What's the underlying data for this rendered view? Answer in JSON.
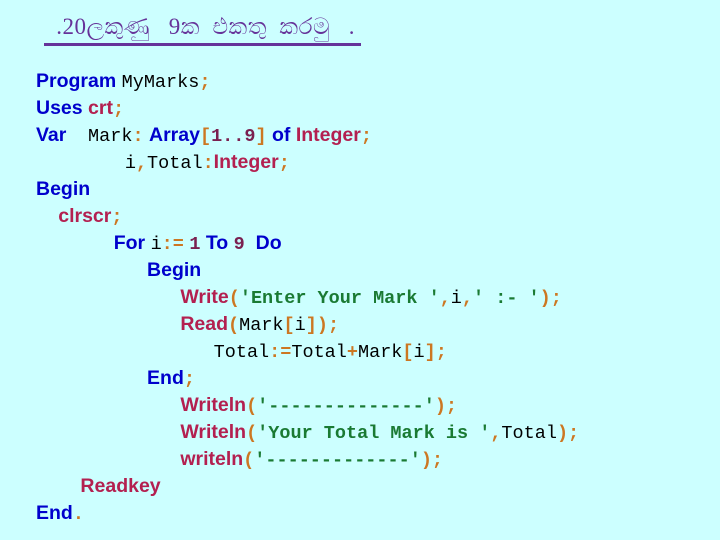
{
  "slide": {
    "background_color": "#ccffff",
    "title": {
      "text": " .20ලකුණු   9ක  එකතු  කරමු   .",
      "color": "#663399",
      "underlined": true
    }
  },
  "colors": {
    "keyword": "#0000cc",
    "identifier": "#000000",
    "procedure": "#b32050",
    "type": "#b32050",
    "punctuation": "#cc7722",
    "number": "#7a2050",
    "string": "#1a7a33",
    "background": "#ccffff",
    "title": "#663399"
  },
  "code": {
    "language": "Pascal",
    "program_name": "MyMarks",
    "lines": [
      {
        "indent": "",
        "tokens": [
          {
            "t": "Program",
            "c": "kw"
          },
          {
            "t": " ",
            "c": "sp"
          },
          {
            "t": "MyMarks",
            "c": "id"
          },
          {
            "t": ";",
            "c": "punc"
          }
        ]
      },
      {
        "indent": "",
        "tokens": [
          {
            "t": "Uses",
            "c": "kw"
          },
          {
            "t": " ",
            "c": "sp"
          },
          {
            "t": "crt",
            "c": "proc"
          },
          {
            "t": ";",
            "c": "punc"
          }
        ]
      },
      {
        "indent": "",
        "tokens": [
          {
            "t": "Var",
            "c": "kw"
          },
          {
            "t": "    ",
            "c": "sp"
          },
          {
            "t": "Mark",
            "c": "id"
          },
          {
            "t": ":",
            "c": "punc"
          },
          {
            "t": " ",
            "c": "sp"
          },
          {
            "t": "Array",
            "c": "kw"
          },
          {
            "t": "[",
            "c": "punc"
          },
          {
            "t": "1..9",
            "c": "num"
          },
          {
            "t": "]",
            "c": "punc"
          },
          {
            "t": " ",
            "c": "sp"
          },
          {
            "t": "of",
            "c": "kw"
          },
          {
            "t": " ",
            "c": "sp"
          },
          {
            "t": "Integer",
            "c": "type"
          },
          {
            "t": ";",
            "c": "punc"
          }
        ]
      },
      {
        "indent": "        ",
        "tokens": [
          {
            "t": "i",
            "c": "id"
          },
          {
            "t": ",",
            "c": "punc"
          },
          {
            "t": "Total",
            "c": "id"
          },
          {
            "t": ":",
            "c": "punc"
          },
          {
            "t": "Integer",
            "c": "type"
          },
          {
            "t": ";",
            "c": "punc"
          }
        ]
      },
      {
        "indent": "",
        "tokens": [
          {
            "t": "Begin",
            "c": "kw"
          }
        ]
      },
      {
        "indent": "  ",
        "tokens": [
          {
            "t": "clrscr",
            "c": "proc"
          },
          {
            "t": ";",
            "c": "punc"
          }
        ]
      },
      {
        "indent": "       ",
        "tokens": [
          {
            "t": "For",
            "c": "kw"
          },
          {
            "t": " ",
            "c": "sp"
          },
          {
            "t": "i",
            "c": "id"
          },
          {
            "t": ":=",
            "c": "punc"
          },
          {
            "t": " ",
            "c": "sp"
          },
          {
            "t": "1",
            "c": "num"
          },
          {
            "t": " ",
            "c": "sp"
          },
          {
            "t": "To",
            "c": "kw"
          },
          {
            "t": " ",
            "c": "sp"
          },
          {
            "t": "9",
            "c": "num"
          },
          {
            "t": "  ",
            "c": "sp"
          },
          {
            "t": "Do",
            "c": "kw"
          }
        ]
      },
      {
        "indent": "          ",
        "tokens": [
          {
            "t": "Begin",
            "c": "kw"
          }
        ]
      },
      {
        "indent": "             ",
        "tokens": [
          {
            "t": "Write",
            "c": "proc"
          },
          {
            "t": "(",
            "c": "punc"
          },
          {
            "t": "'Enter Your Mark '",
            "c": "str"
          },
          {
            "t": ",",
            "c": "punc"
          },
          {
            "t": "i",
            "c": "id"
          },
          {
            "t": ",",
            "c": "punc"
          },
          {
            "t": "' :- '",
            "c": "str"
          },
          {
            "t": ")",
            "c": "punc"
          },
          {
            "t": ";",
            "c": "punc"
          }
        ]
      },
      {
        "indent": "             ",
        "tokens": [
          {
            "t": "Read",
            "c": "proc"
          },
          {
            "t": "(",
            "c": "punc"
          },
          {
            "t": "Mark",
            "c": "id"
          },
          {
            "t": "[",
            "c": "punc"
          },
          {
            "t": "i",
            "c": "id"
          },
          {
            "t": "]",
            "c": "punc"
          },
          {
            "t": ")",
            "c": "punc"
          },
          {
            "t": ";",
            "c": "punc"
          }
        ]
      },
      {
        "indent": "                ",
        "tokens": [
          {
            "t": "Total",
            "c": "id"
          },
          {
            "t": ":=",
            "c": "punc"
          },
          {
            "t": "Total",
            "c": "id"
          },
          {
            "t": "+",
            "c": "punc"
          },
          {
            "t": "Mark",
            "c": "id"
          },
          {
            "t": "[",
            "c": "punc"
          },
          {
            "t": "i",
            "c": "id"
          },
          {
            "t": "]",
            "c": "punc"
          },
          {
            "t": ";",
            "c": "punc"
          }
        ]
      },
      {
        "indent": "          ",
        "tokens": [
          {
            "t": "End",
            "c": "kw"
          },
          {
            "t": ";",
            "c": "punc"
          }
        ]
      },
      {
        "indent": "             ",
        "tokens": [
          {
            "t": "Writeln",
            "c": "proc"
          },
          {
            "t": "(",
            "c": "punc"
          },
          {
            "t": "'--------------'",
            "c": "str"
          },
          {
            "t": ")",
            "c": "punc"
          },
          {
            "t": ";",
            "c": "punc"
          }
        ]
      },
      {
        "indent": "             ",
        "tokens": [
          {
            "t": "Writeln",
            "c": "proc"
          },
          {
            "t": "(",
            "c": "punc"
          },
          {
            "t": "'Your Total Mark is '",
            "c": "str"
          },
          {
            "t": ",",
            "c": "punc"
          },
          {
            "t": "Total",
            "c": "id"
          },
          {
            "t": ")",
            "c": "punc"
          },
          {
            "t": ";",
            "c": "punc"
          }
        ]
      },
      {
        "indent": "             ",
        "tokens": [
          {
            "t": "writeln",
            "c": "proc"
          },
          {
            "t": "(",
            "c": "punc"
          },
          {
            "t": "'-------------'",
            "c": "str"
          },
          {
            "t": ")",
            "c": "punc"
          },
          {
            "t": ";",
            "c": "punc"
          }
        ]
      },
      {
        "indent": "    ",
        "tokens": [
          {
            "t": "Readkey",
            "c": "proc"
          }
        ]
      },
      {
        "indent": "",
        "tokens": [
          {
            "t": "End",
            "c": "kw"
          },
          {
            "t": ".",
            "c": "punc"
          }
        ]
      }
    ]
  }
}
